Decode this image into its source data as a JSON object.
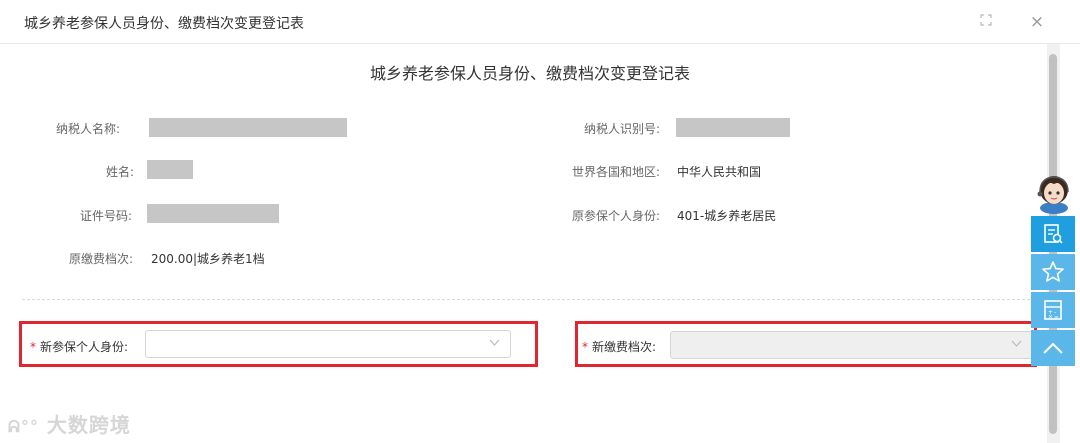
{
  "window": {
    "title": "城乡养老参保人员身份、缴费档次变更登记表",
    "expand_icon": "expand-icon",
    "close_glyph": "×"
  },
  "form": {
    "title": "城乡养老参保人员身份、缴费档次变更登记表",
    "fields": {
      "taxpayer_name_label": "纳税人名称:",
      "taxpayer_id_label": "纳税人识别号:",
      "name_label": "姓名:",
      "country_label": "世界各国和地区:",
      "country_value": "中华人民共和国",
      "id_no_label": "证件号码:",
      "orig_identity_label": "原参保个人身份:",
      "orig_identity_value": "401-城乡养老居民",
      "orig_grade_label": "原缴费档次:",
      "orig_grade_value": "200.00|城乡养老1档"
    },
    "new_identity": {
      "required_mark": "*",
      "label": "新参保个人身份:",
      "value": ""
    },
    "new_grade": {
      "required_mark": "*",
      "label": "新缴费档次:",
      "value": ""
    }
  },
  "side_panel": {
    "items": [
      "view-icon",
      "star-icon",
      "calculator-icon",
      "chevron-up-icon"
    ]
  },
  "watermark": "大数跨境",
  "colors": {
    "highlight": "#e0262e",
    "panel_blue": "#5bb6ea",
    "panel_active": "#1f9ee0"
  }
}
